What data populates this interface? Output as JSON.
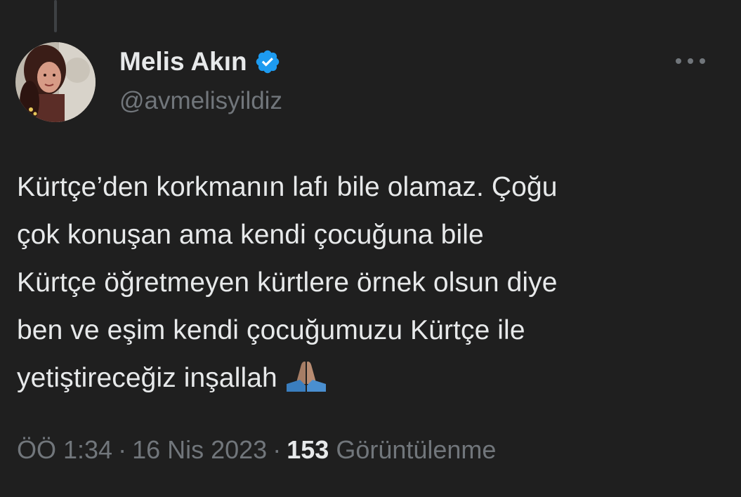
{
  "tweet": {
    "author": {
      "display_name": "Melis Akın",
      "handle": "@avmelisyildiz",
      "verified_icon": "verified-badge-icon",
      "verified_color": "#1d9bf0"
    },
    "more_icon": "more-options-icon",
    "text_lines": [
      "Kürtçe’den korkmanın lafı bile olamaz. Çoğu",
      "çok konuşan ama kendi çocuğuna bile",
      "Kürtçe öğretmeyen kürtlere örnek olsun diye",
      "ben ve eşim kendi çocuğumuzu Kürtçe ile",
      "yetiştireceğiz inşallah"
    ],
    "emoji": "folded-hands-emoji",
    "time": "ÖÖ 1:34",
    "separator": "·",
    "date": "16 Nis 2023",
    "views_count": "153",
    "views_label": "Görüntülenme"
  },
  "colors": {
    "background": "#1f1f1f",
    "text": "#e7e9ea",
    "secondary_text": "#71767b",
    "accent": "#1d9bf0"
  }
}
